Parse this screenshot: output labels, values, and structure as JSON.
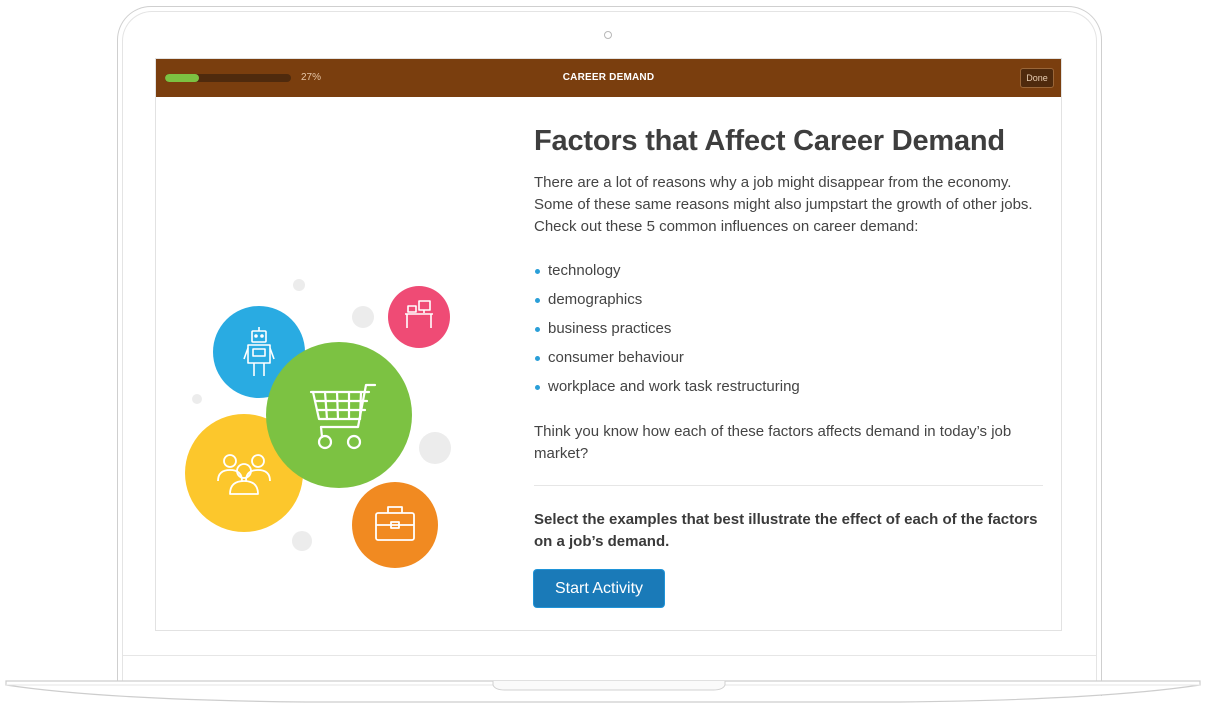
{
  "topbar": {
    "progress_percent": 27,
    "progress_label": "27%",
    "title": "CAREER DEMAND",
    "done_label": "Done"
  },
  "content": {
    "heading": "Factors that Affect Career Demand",
    "intro": "There are a lot of reasons why a job might disappear from the economy. Some of these same reasons might also jumpstart the growth of other jobs. Check out these 5 common influences on career demand:",
    "factors": [
      "technology",
      "demographics",
      "business practices",
      "consumer behaviour",
      "workplace and work task restructuring"
    ],
    "question": "Think you know how each of these factors affects demand in today’s job market?",
    "instruction": "Select the examples that best illustrate the effect of each of the factors on a job’s demand.",
    "start_label": "Start Activity"
  },
  "colors": {
    "topbar_bg": "#7a3e0e",
    "progress_fill": "#7cc242",
    "button_bg": "#1a7ab8",
    "bullet": "#2a9fd8",
    "circle_blue": "#29abe2",
    "circle_green": "#7cc242",
    "circle_yellow": "#fcc72c",
    "circle_pink": "#ef4b75",
    "circle_orange": "#f18a21"
  },
  "illustration": {
    "icons": [
      "robot-icon",
      "shopping-cart-icon",
      "people-group-icon",
      "desk-computer-icon",
      "briefcase-icon"
    ]
  }
}
